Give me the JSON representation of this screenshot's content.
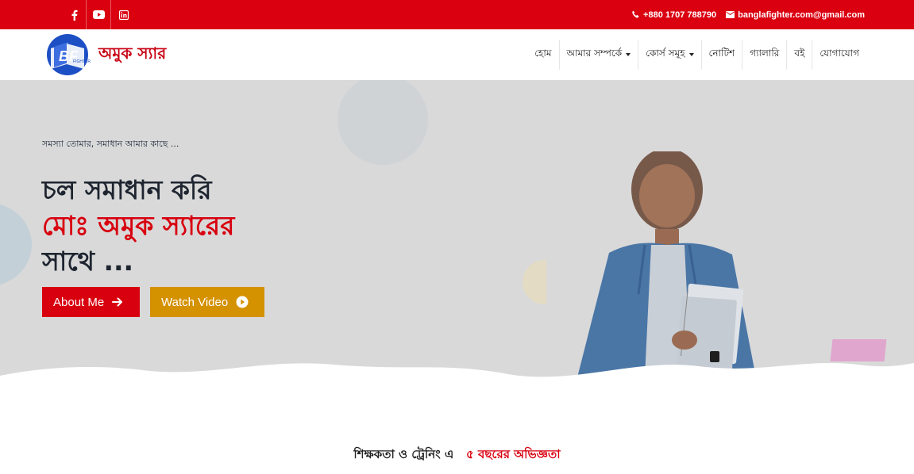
{
  "topbar": {
    "social": [
      {
        "icon": "facebook-icon"
      },
      {
        "icon": "youtube-icon"
      },
      {
        "icon": "linkedin-icon"
      }
    ],
    "phone": "+880 1707 788790",
    "email": "banglafighter.com@gmail.com",
    "bg_color": "#da0010"
  },
  "header": {
    "logo_text": "অমুক স্যার",
    "nav": [
      {
        "label": "হোম",
        "dropdown": false
      },
      {
        "label": "আমার সম্পর্কে",
        "dropdown": true
      },
      {
        "label": "কোর্স সমূহ",
        "dropdown": true
      },
      {
        "label": "নোটিশ",
        "dropdown": false
      },
      {
        "label": "গ্যালারি",
        "dropdown": false
      },
      {
        "label": "বই",
        "dropdown": false
      },
      {
        "label": "যোগাযোগ",
        "dropdown": false
      }
    ]
  },
  "hero": {
    "tagline": "সমস্যা তোমার, সমাধান আমার কাছে ...",
    "headline_line1": "চল সমাধান করি",
    "headline_line2": "মোঃ অমুক স্যারের",
    "headline_line3": "সাথে ...",
    "btn_about": "About Me",
    "btn_video": "Watch Video",
    "accent_red": "#d8000f",
    "accent_gold": "#d49100"
  },
  "experience": {
    "prefix": "শিক্ষকতা ও ট্রেনিং এ",
    "highlight": "৫ বছরের অভিজ্ঞতা"
  }
}
